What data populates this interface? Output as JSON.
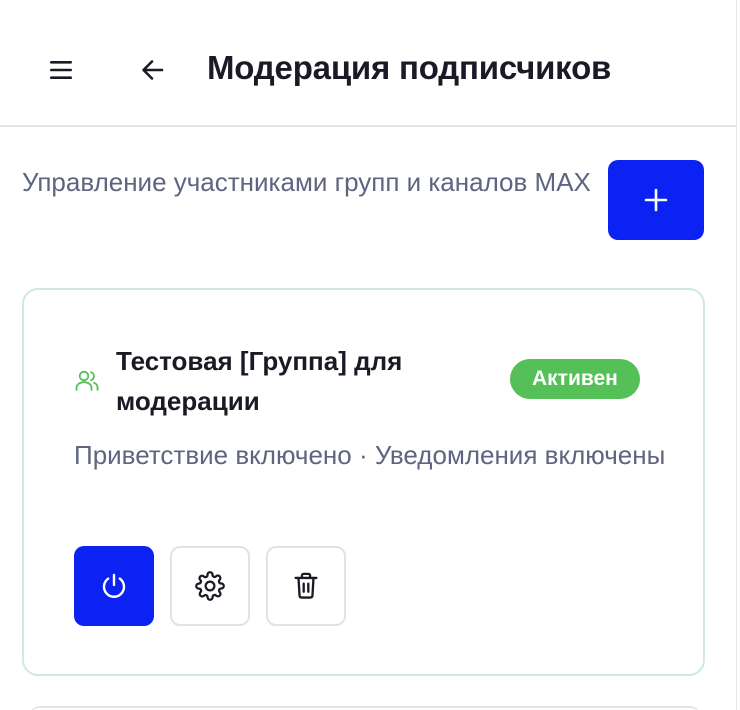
{
  "header": {
    "title": "Модерация подписчиков",
    "menu_icon": "hamburger-menu-icon",
    "back_icon": "arrow-left-icon"
  },
  "page": {
    "subtitle": "Управление участниками групп и каналов MAX",
    "add_icon": "plus-icon"
  },
  "groups": [
    {
      "icon": "users-icon",
      "name": "Тестовая [Группа] для модерации",
      "status": "Активен",
      "description": "Приветствие включено · Уведомления включены",
      "actions": [
        "power-icon",
        "gear-icon",
        "trash-icon"
      ]
    }
  ],
  "colors": {
    "accent": "#0b22f2",
    "active_badge": "#55c057",
    "card_border": "#cfeadd",
    "muted_text": "#5f6480"
  }
}
